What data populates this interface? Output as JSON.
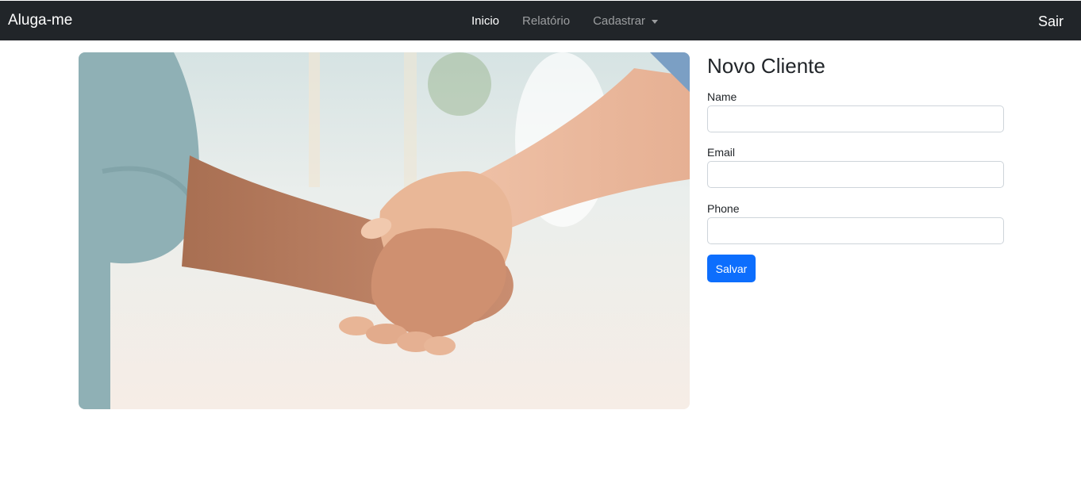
{
  "navbar": {
    "brand": "Aluga-me",
    "links": [
      {
        "label": "Inicio",
        "active": true
      },
      {
        "label": "Relatório",
        "active": false
      }
    ],
    "dropdown_label": "Cadastrar",
    "logout_label": "Sair"
  },
  "form": {
    "title": "Novo Cliente",
    "fields": [
      {
        "label": "Name",
        "value": ""
      },
      {
        "label": "Email",
        "value": ""
      },
      {
        "label": "Phone",
        "value": ""
      }
    ],
    "submit_label": "Salvar",
    "submit_color": "#0d6efd"
  }
}
